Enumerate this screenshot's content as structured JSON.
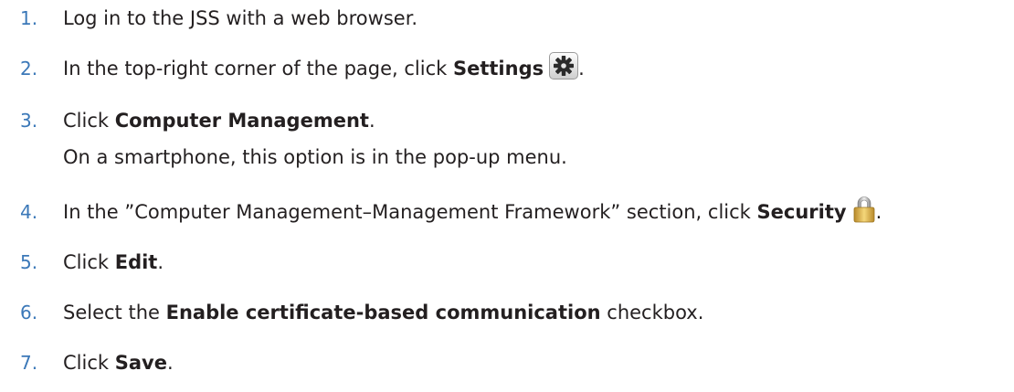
{
  "steps": [
    {
      "number": "1.",
      "text": "Log in to the JSS with a web browser."
    },
    {
      "number": "2.",
      "prefix": "In the top-right corner of the page, click ",
      "bold": "Settings",
      "icon": "gear-icon",
      "suffix": "."
    },
    {
      "number": "3.",
      "prefix": "Click ",
      "bold": "Computer Management",
      "suffix": ".",
      "note": "On a smartphone, this option is in the pop-up menu."
    },
    {
      "number": "4.",
      "prefix": "In the ”Computer Management–Management Framework” section, click ",
      "bold": "Security",
      "icon": "lock-icon",
      "suffix": "."
    },
    {
      "number": "5.",
      "prefix": "Click ",
      "bold": "Edit",
      "suffix": "."
    },
    {
      "number": "6.",
      "prefix": "Select the ",
      "bold": "Enable certificate-based communication",
      "suffix": " checkbox."
    },
    {
      "number": "7.",
      "prefix": "Click ",
      "bold": "Save",
      "suffix": "."
    }
  ]
}
